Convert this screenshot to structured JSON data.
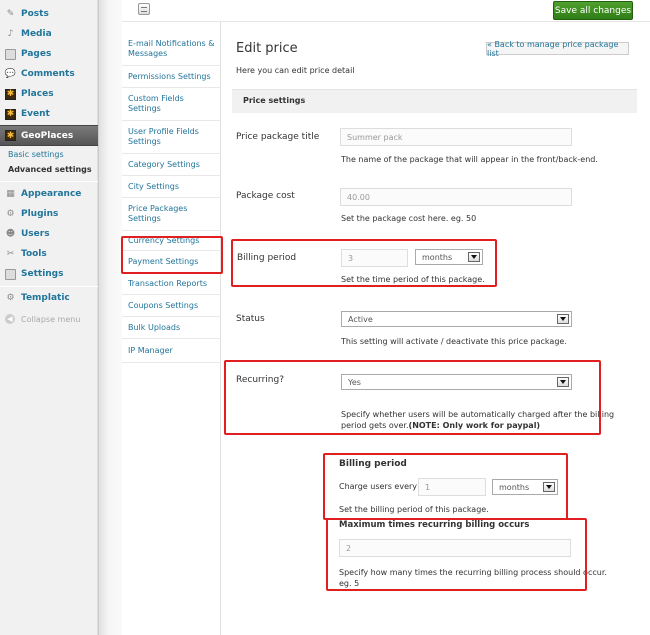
{
  "admin_menu": {
    "items": [
      {
        "label": "Posts",
        "icon": "pin-icon"
      },
      {
        "label": "Media",
        "icon": "media-icon"
      },
      {
        "label": "Pages",
        "icon": "pages-icon"
      },
      {
        "label": "Comments",
        "icon": "comments-icon"
      },
      {
        "label": "Places",
        "icon": "places-icon"
      },
      {
        "label": "Event",
        "icon": "event-icon"
      },
      {
        "label": "GeoPlaces",
        "icon": "geoplaces-icon"
      }
    ],
    "submenu": [
      "Basic settings",
      "Advanced settings"
    ],
    "items2": [
      {
        "label": "Appearance",
        "icon": "appearance-icon"
      },
      {
        "label": "Plugins",
        "icon": "plugins-icon"
      },
      {
        "label": "Users",
        "icon": "users-icon"
      },
      {
        "label": "Tools",
        "icon": "tools-icon"
      },
      {
        "label": "Settings",
        "icon": "settings-icon"
      }
    ],
    "templatic": "Templatic",
    "collapse": "Collapse menu"
  },
  "toolbar": {
    "save_label": "Save all changes"
  },
  "subnav": [
    "E-mail Notifications & Messages",
    "Permissions Settings",
    "Custom Fields Settings",
    "User Profile Fields Settings",
    "Category Settings",
    "City Settings",
    "Price Packages Settings",
    "Currency Settings",
    "Payment Settings",
    "Transaction Reports",
    "Coupons Settings",
    "Bulk Uploads",
    "IP Manager"
  ],
  "page": {
    "title": "Edit price",
    "back_label": "« Back to manage price package list",
    "description": "Here you can edit price detail",
    "section": "Price settings"
  },
  "form": {
    "title_label": "Price package title",
    "title_value": "Summer pack",
    "title_help": "The name of the package that will appear in the front/back-end.",
    "cost_label": "Package cost",
    "cost_value": "40.00",
    "cost_help": "Set the package cost here. eg. 50",
    "billing_label": "Billing period",
    "billing_value": "3",
    "billing_unit": "months",
    "billing_help": "Set the time period of this package.",
    "status_label": "Status",
    "status_value": "Active",
    "status_help": "This setting will activate / deactivate this price package.",
    "recurring_label": "Recurring?",
    "recurring_value": "Yes",
    "recurring_help_1": "Specify whether users will be automatically charged after the billing",
    "recurring_help_2": "period gets over.",
    "recurring_note": "(NOTE: Only work for paypal)",
    "rb_title": "Billing period",
    "rb_charge_label": "Charge users every",
    "rb_value": "1",
    "rb_unit": "months",
    "rb_help": "Set the billing period of this package.",
    "max_title": "Maximum times recurring billing occurs",
    "max_value": "2",
    "max_help_1": "Specify how many times the recurring billing process should occur.",
    "max_help_2": "eg. 5"
  },
  "colors": {
    "highlight": "#e02020",
    "save_button": "#3a8d1f",
    "link": "#21759b"
  }
}
